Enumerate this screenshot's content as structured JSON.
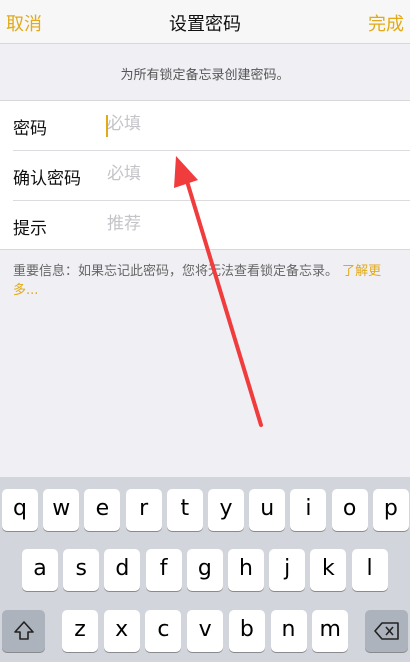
{
  "nav": {
    "cancel": "取消",
    "title": "设置密码",
    "done": "完成"
  },
  "info_text": "为所有锁定备忘录创建密码。",
  "form": {
    "password": {
      "label": "密码",
      "placeholder": "必填"
    },
    "confirm": {
      "label": "确认密码",
      "placeholder": "必填"
    },
    "hint": {
      "label": "提示",
      "placeholder": "推荐"
    }
  },
  "note": {
    "text": "重要信息：如果忘记此密码，您将无法查看锁定备忘录。",
    "link": "了解更多..."
  },
  "accent_color": "#e2aa16",
  "keyboard": {
    "row1": [
      "q",
      "w",
      "e",
      "r",
      "t",
      "y",
      "u",
      "i",
      "o",
      "p"
    ],
    "row2": [
      "a",
      "s",
      "d",
      "f",
      "g",
      "h",
      "j",
      "k",
      "l"
    ],
    "row3": [
      "z",
      "x",
      "c",
      "v",
      "b",
      "n",
      "m"
    ],
    "shift_icon": "shift-icon",
    "delete_icon": "backspace-icon"
  }
}
